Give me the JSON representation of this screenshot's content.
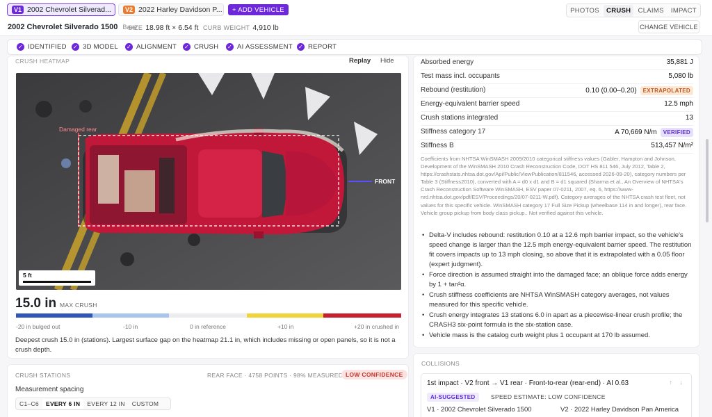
{
  "vehicle_tabs": [
    {
      "badge": "V1",
      "label": "2002 Chevrolet Silverad...",
      "close": "×"
    },
    {
      "badge": "V2",
      "label": "2022 Harley Davidson P...",
      "close": "×"
    }
  ],
  "add_vehicle_label": "+ ADD VEHICLE",
  "view_tabs": [
    "PHOTOS",
    "CRUSH",
    "CLAIMS",
    "IMPACT"
  ],
  "active_view_tab": "CRUSH",
  "vehicle": {
    "title": "2002 Chevrolet Silverado 1500",
    "trim": "Base",
    "size_label": "SIZE",
    "size_value": "18.98 ft × 6.54 ft",
    "curb_label": "CURB WEIGHT",
    "curb_value": "4,910 lb"
  },
  "change_vehicle_label": "CHANGE VEHICLE",
  "steps": [
    "IDENTIFIED",
    "3D MODEL",
    "ALIGNMENT",
    "CRUSH",
    "AI ASSESSMENT",
    "REPORT"
  ],
  "heatmap": {
    "label": "CRUSH HEATMAP",
    "replay_label": "Replay",
    "hide_label": "Hide",
    "damaged_label": "Damaged rear",
    "front_label": "FRONT",
    "scale_label": "5 ft"
  },
  "max_crush": {
    "value": "15.0 in",
    "label": "MAX CRUSH"
  },
  "colors": {
    "accent": "#6d28d9",
    "scale_blue": "#2f56b8",
    "scale_lightblue": "#a7c6ee",
    "scale_neutral": "#ececee",
    "scale_yellow": "#f0d43a",
    "scale_red": "#c8202f",
    "car_red": "#c1183a"
  },
  "crush_scale_ticks": [
    "-20 in bulged out",
    "-10 in",
    "0 in reference",
    "+10 in",
    "+20 in crushed in"
  ],
  "deepest_note": "Deepest crush 15.0 in (stations). Largest surface gap on the heatmap 21.1 in, which includes missing or open panels, so it is not a crush depth.",
  "crush_stations": {
    "title": "CRUSH STATIONS",
    "meta": "REAR FACE · 4758 POINTS · 98% MEASURED",
    "confidence": "LOW CONFIDENCE",
    "spacing_label": "Measurement spacing",
    "spacing_options": [
      "C1–C6",
      "EVERY 6 IN",
      "EVERY 12 IN",
      "CUSTOM"
    ],
    "active_spacing": "EVERY 6 IN"
  },
  "metrics": [
    {
      "label": "Absorbed energy",
      "value": "35,881 J"
    },
    {
      "label": "Test mass incl. occupants",
      "value": "5,080 lb"
    },
    {
      "label": "Rebound (restitution)",
      "value": "0.10 (0.00–0.20)",
      "tag": "EXTRAPOLATED"
    },
    {
      "label": "Energy-equivalent barrier speed",
      "value": "12.5 mph"
    },
    {
      "label": "Crush stations integrated",
      "value": "13"
    },
    {
      "label": "Stiffness category 17",
      "value": "A 70,669 N/m",
      "tag": "VERIFIED"
    },
    {
      "label": "Stiffness B",
      "value": "513,457 N/m²"
    }
  ],
  "coefficients_note": "Coefficients from NHTSA WinSMASH 2009/2010 categorical stiffness values (Gabler, Hampton and Johnson, Development of the WinSMASH 2010 Crash Reconstruction Code, DOT HS 811 546, July 2012, Table 2, https://crashstats.nhtsa.dot.gov/Api/Public/ViewPublication/811546, accessed 2026-09-20), category numbers per Table 3 (Stiffness2010), converted with A = d0 x d1 and B = d1 squared (Sharma et al., An Overview of NHTSA's Crash Reconstruction Software WinSMASH, ESV paper 07-0211, 2007, eq. 6, https://www-nrd.nhtsa.dot.gov/pdf/ESV/Proceedings/20/07-0211-W.pdf). Category averages of the NHTSA crash test fleet, not values for this specific vehicle. WinSMASH category 17 Full Size Pickup (wheelbase 114 in and longer), rear face. Vehicle group pickup from body class pickup.. Not verified against this vehicle.",
  "bullets": [
    "Delta-V includes rebound: restitution 0.10 at a 12.6 mph barrier impact, so the vehicle's speed change is larger than the 12.5 mph energy-equivalent barrier speed. The restitution fit covers impacts up to 13 mph closing, so above that it is extrapolated with a 0.05 floor (expert judgment).",
    "Force direction is assumed straight into the damaged face; an oblique force adds energy by 1 + tan²α.",
    "Crush stiffness coefficients are NHTSA WinSMASH category averages, not values measured for this specific vehicle.",
    "Crush energy integrates 13 stations 6.0 in apart as a piecewise-linear crush profile; the CRASH3 six-point formula is the six-station case.",
    "Vehicle mass is the catalog curb weight plus 1 occupant at 170 lb assumed."
  ],
  "collisions": {
    "title": "COLLISIONS",
    "impact_label": "1st impact · V2 front → V1 rear · Front-to-rear (rear-end) · AI 0.63",
    "ai_tag": "AI-SUGGESTED",
    "speed_estimate": "SPEED ESTIMATE: LOW CONFIDENCE",
    "v1_name": "V1 · 2002 Chevrolet Silverado 1500",
    "v2_name": "V2 · 2022 Harley Davidson Pan America",
    "arrows": "↑ ↓"
  }
}
